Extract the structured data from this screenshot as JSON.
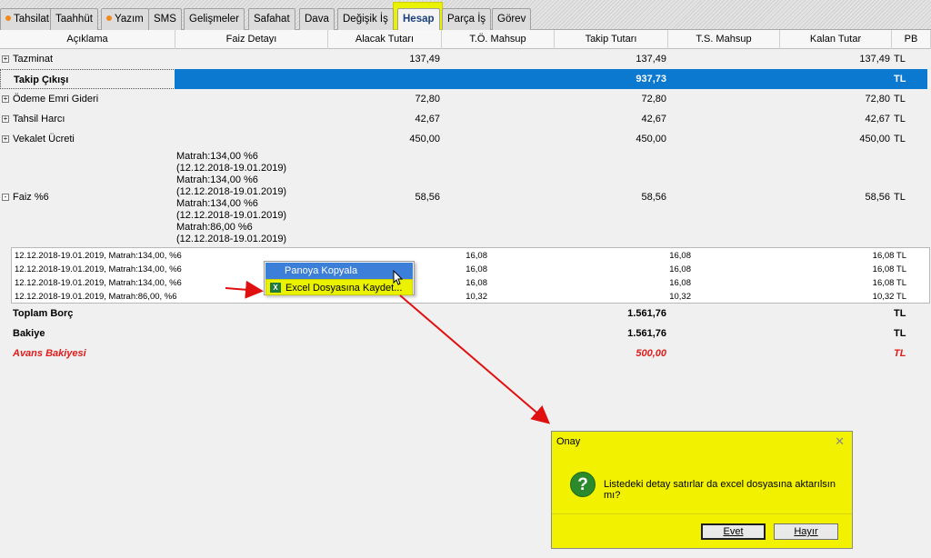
{
  "tabs": [
    {
      "label": "Tahsilat",
      "dot": true
    },
    {
      "label": "Taahhüt",
      "dot": false
    },
    {
      "label": "Yazım",
      "dot": true
    },
    {
      "label": "SMS",
      "dot": false
    },
    {
      "label": "Gelişmeler",
      "dot": false
    },
    {
      "label": "Safahat",
      "dot": false
    },
    {
      "label": "Dava",
      "dot": false
    },
    {
      "label": "Değişik İş",
      "dot": false
    },
    {
      "label": "Hesap",
      "dot": false,
      "active": true
    },
    {
      "label": "Parça İş",
      "dot": false
    },
    {
      "label": "Görev",
      "dot": false
    }
  ],
  "columns": [
    "Açıklama",
    "Faiz Detayı",
    "Alacak Tutarı",
    "T.Ö. Mahsup",
    "Takip Tutarı",
    "T.S. Mahsup",
    "Kalan Tutar",
    "PB"
  ],
  "rows": [
    {
      "desc": "Tazminat",
      "expand": "+",
      "alacak": "137,49",
      "takip": "137,49",
      "kalan": "137,49",
      "pb": "TL"
    },
    {
      "desc": "Takip Çıkışı",
      "takip": "937,73",
      "pb": "TL",
      "selected": true
    },
    {
      "desc": "Ödeme Emri Gideri",
      "expand": "+",
      "alacak": "72,80",
      "takip": "72,80",
      "kalan": "72,80",
      "pb": "TL"
    },
    {
      "desc": "Tahsil Harcı",
      "expand": "+",
      "alacak": "42,67",
      "takip": "42,67",
      "kalan": "42,67",
      "pb": "TL"
    },
    {
      "desc": "Vekalet Ücreti",
      "expand": "+",
      "alacak": "450,00",
      "takip": "450,00",
      "kalan": "450,00",
      "pb": "TL"
    },
    {
      "desc": "Faiz  %6",
      "expand": "-",
      "alacak": "58,56",
      "takip": "58,56",
      "kalan": "58,56",
      "pb": "TL"
    }
  ],
  "faiz_detail": [
    "Matrah:134,00 %6",
    "(12.12.2018-19.01.2019)",
    "Matrah:134,00 %6",
    "(12.12.2018-19.01.2019)",
    "Matrah:134,00 %6",
    "(12.12.2018-19.01.2019)",
    "Matrah:86,00 %6",
    "(12.12.2018-19.01.2019)"
  ],
  "sub_rows": [
    {
      "desc": "12.12.2018-19.01.2019, Matrah:134,00, %6",
      "alacak": "16,08",
      "takip": "16,08",
      "kalan": "16,08 TL"
    },
    {
      "desc": "12.12.2018-19.01.2019, Matrah:134,00, %6",
      "alacak": "16,08",
      "takip": "16,08",
      "kalan": "16,08 TL"
    },
    {
      "desc": "12.12.2018-19.01.2019, Matrah:134,00, %6",
      "alacak": "16,08",
      "takip": "16,08",
      "kalan": "16,08 TL"
    },
    {
      "desc": "12.12.2018-19.01.2019, Matrah:86,00, %6",
      "alacak": "10,32",
      "takip": "10,32",
      "kalan": "10,32 TL"
    }
  ],
  "totals": [
    {
      "label": "Toplam Borç",
      "takip": "1.561,76",
      "pb": "TL"
    },
    {
      "label": "Bakiye",
      "takip": "1.561,76",
      "pb": "TL"
    },
    {
      "label": "Avans Bakiyesi",
      "takip": "500,00",
      "pb": "TL",
      "red": true
    }
  ],
  "context_menu": {
    "copy": "Panoya Kopyala",
    "excel": "Excel Dosyasına Kaydet..."
  },
  "dialog": {
    "title": "Onay",
    "message": "Listedeki detay satırlar da excel dosyasına aktarılsın mı?",
    "yes": "Evet",
    "no": "Hayır",
    "close": "✕",
    "icon": "?"
  },
  "colors": {
    "highlight": "#eaf200",
    "selection": "#0b79d0",
    "arrow": "#e01010",
    "negative": "#e11b1b"
  }
}
